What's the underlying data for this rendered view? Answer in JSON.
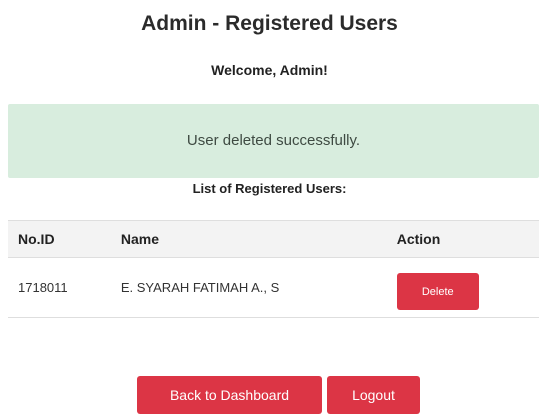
{
  "header": {
    "title": "Admin - Registered Users",
    "welcome": "Welcome, Admin!"
  },
  "alert": {
    "message": "User deleted successfully.",
    "color": "#d8edde"
  },
  "list": {
    "heading": "List of Registered Users:",
    "columns": {
      "id": "No.ID",
      "name": "Name",
      "action": "Action"
    },
    "rows": [
      {
        "id": "1718011",
        "name": "E. SYARAH FATIMAH A., S",
        "action_label": "Delete"
      }
    ]
  },
  "footer": {
    "dashboard_label": "Back to Dashboard",
    "logout_label": "Logout"
  },
  "colors": {
    "danger": "#dc3545",
    "header_bg": "#f3f3f3"
  }
}
